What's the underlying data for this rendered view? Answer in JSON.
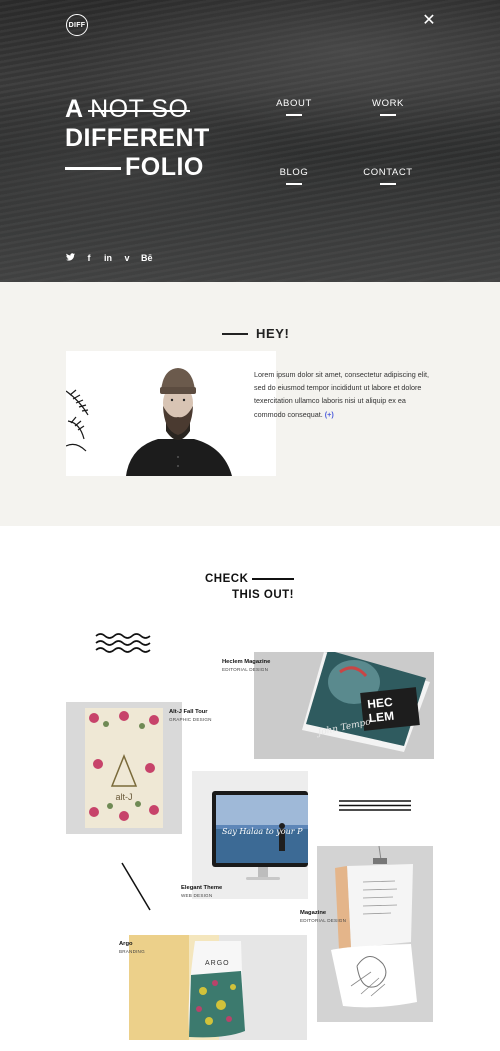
{
  "header": {
    "logo_text": "DIFF",
    "close_glyph": "✕"
  },
  "hero": {
    "word_a": "A",
    "word_strike": "NOT SO",
    "word_different": "DIFFERENT",
    "word_folio": "FOLIO"
  },
  "nav": {
    "about": "ABOUT",
    "work": "WORK",
    "blog": "BLOG",
    "contact": "CONTACT"
  },
  "social": {
    "twitter": "twitter-icon",
    "facebook": "facebook-icon",
    "linkedin": "linkedin-icon",
    "vimeo": "vimeo-icon",
    "behance": "behance-icon",
    "glyphs": {
      "twitter": "🐦",
      "facebook": "f",
      "linkedin": "in",
      "vimeo": "v",
      "behance": "Bē"
    }
  },
  "about": {
    "heading": "HEY!",
    "body": "Lorem ipsum dolor sit amet, consectetur adipiscing elit, sed do eiusmod tempor incididunt ut labore et dolore texercitation ullamco laboris nisi ut aliquip ex ea commodo consequat.",
    "more_link": "(+)"
  },
  "works": {
    "heading_line1": "CHECK",
    "heading_line2": "THIS OUT!",
    "projects": [
      {
        "title": "Heclem Magazine",
        "category": "EDITORIAL DESIGN"
      },
      {
        "title": "Alt-J Fall Tour",
        "category": "GRAPHIC DESIGN"
      },
      {
        "title": "Elegant Theme",
        "category": "WEB DESIGN"
      },
      {
        "title": "Magazine",
        "category": "EDITORIAL DESIGN"
      },
      {
        "title": "Argo",
        "category": "BRANDING"
      }
    ],
    "mock_texts": {
      "heclem_cover": "HEC LEM",
      "heclem_script": "John Tempo",
      "altj_cover": "alt-J",
      "theme_screen": "Say Halaa to your P",
      "argo_cover": "ARGO"
    }
  },
  "colors": {
    "hero_bg": "#2f3030",
    "about_bg": "#f4f3ef",
    "link_accent": "#4a5adb",
    "text_dark": "#222222"
  }
}
